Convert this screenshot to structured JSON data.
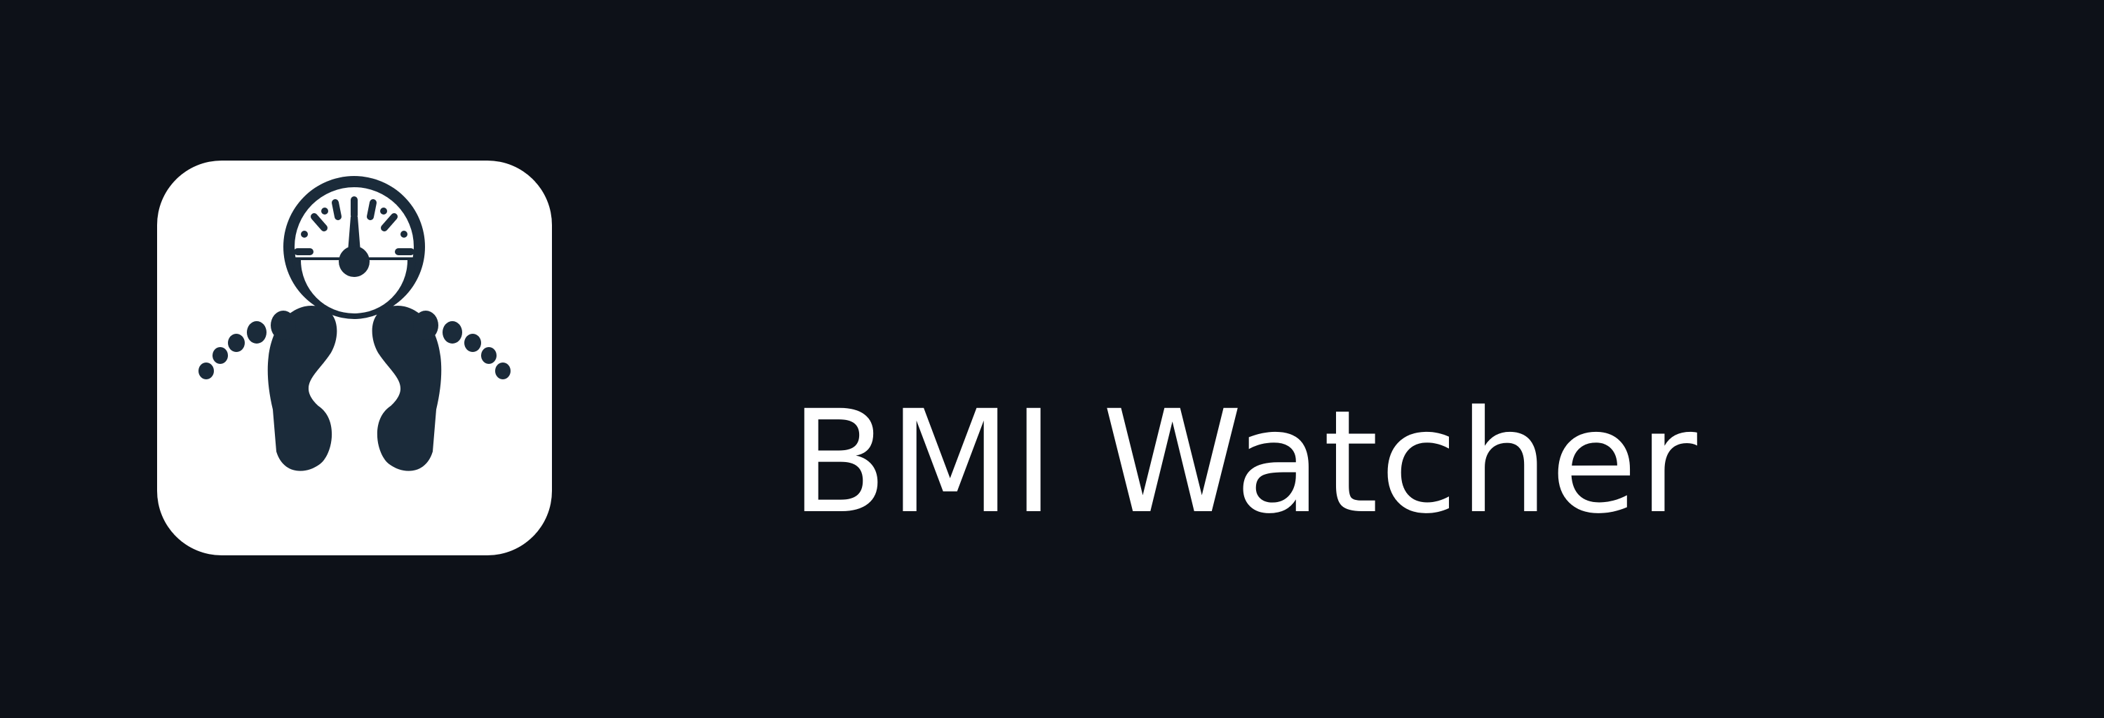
{
  "app": {
    "name": "BMI Watcher"
  },
  "logo": {
    "icon": "bathroom-scale-with-footprints-icon",
    "tile_color": "#ffffff",
    "icon_color": "#1b2b3a"
  },
  "theme": {
    "background": "#0d1118",
    "text_color": "#ffffff"
  }
}
